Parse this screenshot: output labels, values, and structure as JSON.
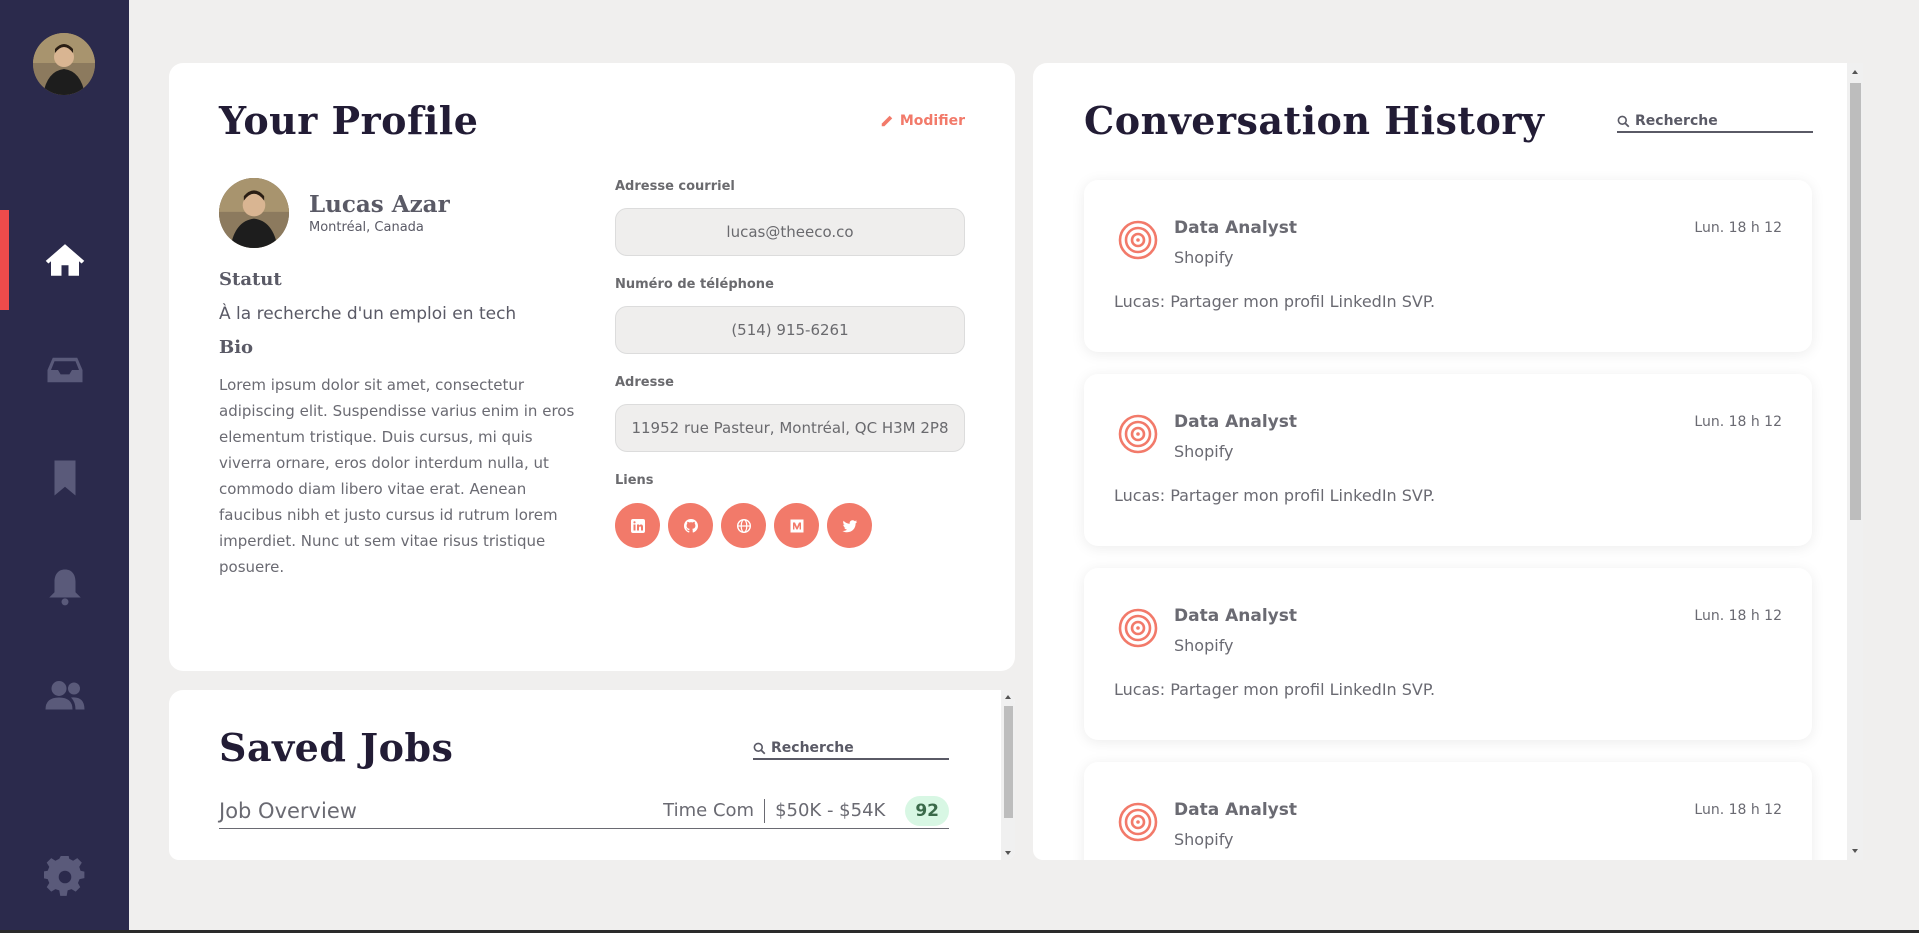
{
  "sidebar": {
    "nav": [
      {
        "icon": "home-icon",
        "active": true
      },
      {
        "icon": "inbox-icon"
      },
      {
        "icon": "bookmark-icon"
      },
      {
        "icon": "bell-icon"
      },
      {
        "icon": "users-icon"
      },
      {
        "icon": "gear-icon"
      }
    ],
    "accent": "#ee4b4b",
    "background": "#2b2a4c"
  },
  "profile": {
    "title": "Your Profile",
    "edit_label": "Modifier",
    "name": "Lucas Azar",
    "location": "Montréal, Canada",
    "status_heading": "Statut",
    "status": "À la recherche d'un emploi en tech",
    "bio_heading": "Bio",
    "bio": "Lorem ipsum dolor sit amet, consectetur adipiscing elit. Suspendisse varius enim in eros elementum tristique. Duis cursus, mi quis viverra ornare, eros dolor interdum nulla, ut commodo diam libero vitae erat. Aenean faucibus nibh et justo cursus id rutrum lorem imperdiet. Nunc ut sem vitae risus tristique posuere.",
    "email_label": "Adresse courriel",
    "email": "lucas@theeco.co",
    "phone_label": "Numéro de téléphone",
    "phone": "(514) 915-6261",
    "address_label": "Adresse",
    "address": "11952 rue Pasteur, Montréal, QC H3M 2P8",
    "links_label": "Liens",
    "links": [
      "linkedin-icon",
      "github-icon",
      "globe-icon",
      "medium-icon",
      "twitter-icon"
    ],
    "accent": "#f27a6a"
  },
  "saved_jobs": {
    "title": "Saved Jobs",
    "search_placeholder": "Recherche",
    "rows": [
      {
        "title": "Job Overview",
        "type": "Time Com",
        "salary": "$50K - $54K",
        "score": "92"
      }
    ]
  },
  "conversations": {
    "title": "Conversation History",
    "search_placeholder": "Recherche",
    "items": [
      {
        "title": "Data Analyst",
        "company": "Shopify",
        "time": "Lun. 18 h 12",
        "message": "Lucas: Partager mon profil LinkedIn SVP."
      },
      {
        "title": "Data Analyst",
        "company": "Shopify",
        "time": "Lun. 18 h 12",
        "message": "Lucas: Partager mon profil LinkedIn SVP."
      },
      {
        "title": "Data Analyst",
        "company": "Shopify",
        "time": "Lun. 18 h 12",
        "message": "Lucas: Partager mon profil LinkedIn SVP."
      },
      {
        "title": "Data Analyst",
        "company": "Shopify",
        "time": "Lun. 18 h 12",
        "message": ""
      }
    ]
  }
}
